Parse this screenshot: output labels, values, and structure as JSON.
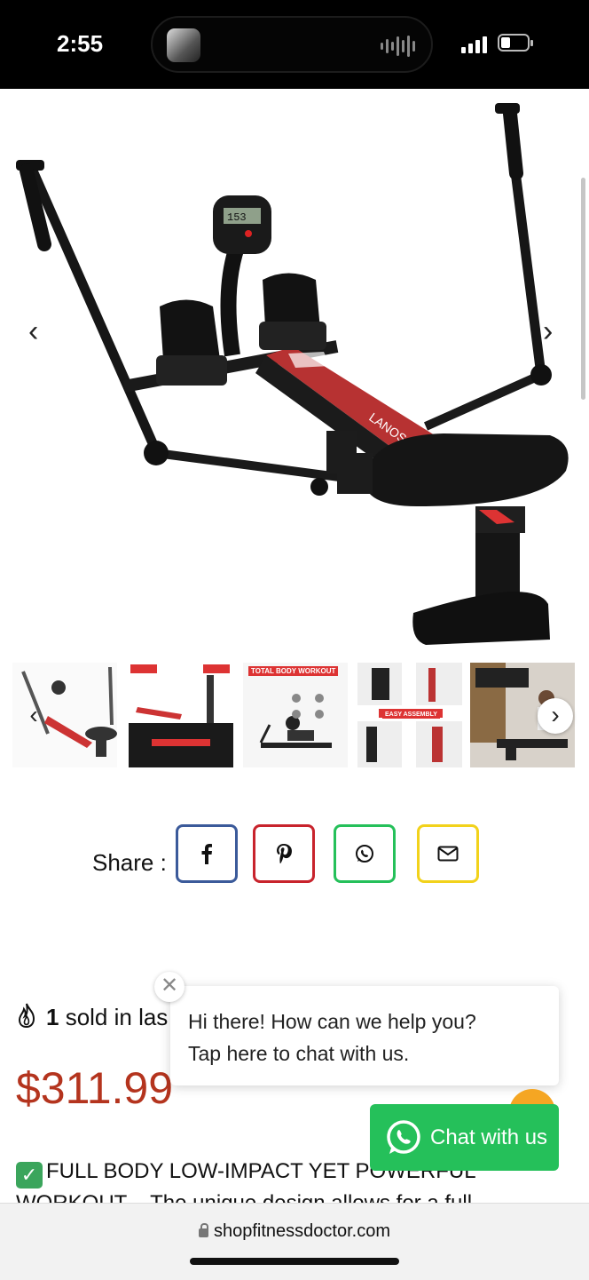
{
  "status_bar": {
    "time": "2:55"
  },
  "gallery": {
    "prev_icon": "chevron-left-icon",
    "next_icon": "chevron-right-icon",
    "thumbnails": [
      {
        "caption": ""
      },
      {
        "caption": ""
      },
      {
        "caption": "TOTAL BODY WORKOUT"
      },
      {
        "caption": "EASY ASSEMBLY"
      },
      {
        "caption": ""
      }
    ]
  },
  "share": {
    "label": "Share :",
    "buttons": [
      {
        "icon": "facebook-icon",
        "glyph": "f",
        "color": "#3b5a9a"
      },
      {
        "icon": "pinterest-icon",
        "glyph": "p",
        "color": "#c8232c"
      },
      {
        "icon": "whatsapp-icon",
        "glyph": "✆",
        "color": "#25c05a"
      },
      {
        "icon": "email-icon",
        "glyph": "✉",
        "color": "#f2d21b"
      }
    ]
  },
  "sold": {
    "count": "1",
    "text": " sold in las"
  },
  "price": "$311.99",
  "description": "FULL BODY LOW-IMPACT YET POWERFUL WORKOUT – The unique design allows for a full-",
  "chat_popup": {
    "line1": "Hi there! How can we help you?",
    "line2": "Tap here to chat with us.",
    "close": "✕"
  },
  "whatsapp_button": {
    "label": "Chat with us"
  },
  "url_bar": {
    "domain": "shopfitnessdoctor.com"
  }
}
